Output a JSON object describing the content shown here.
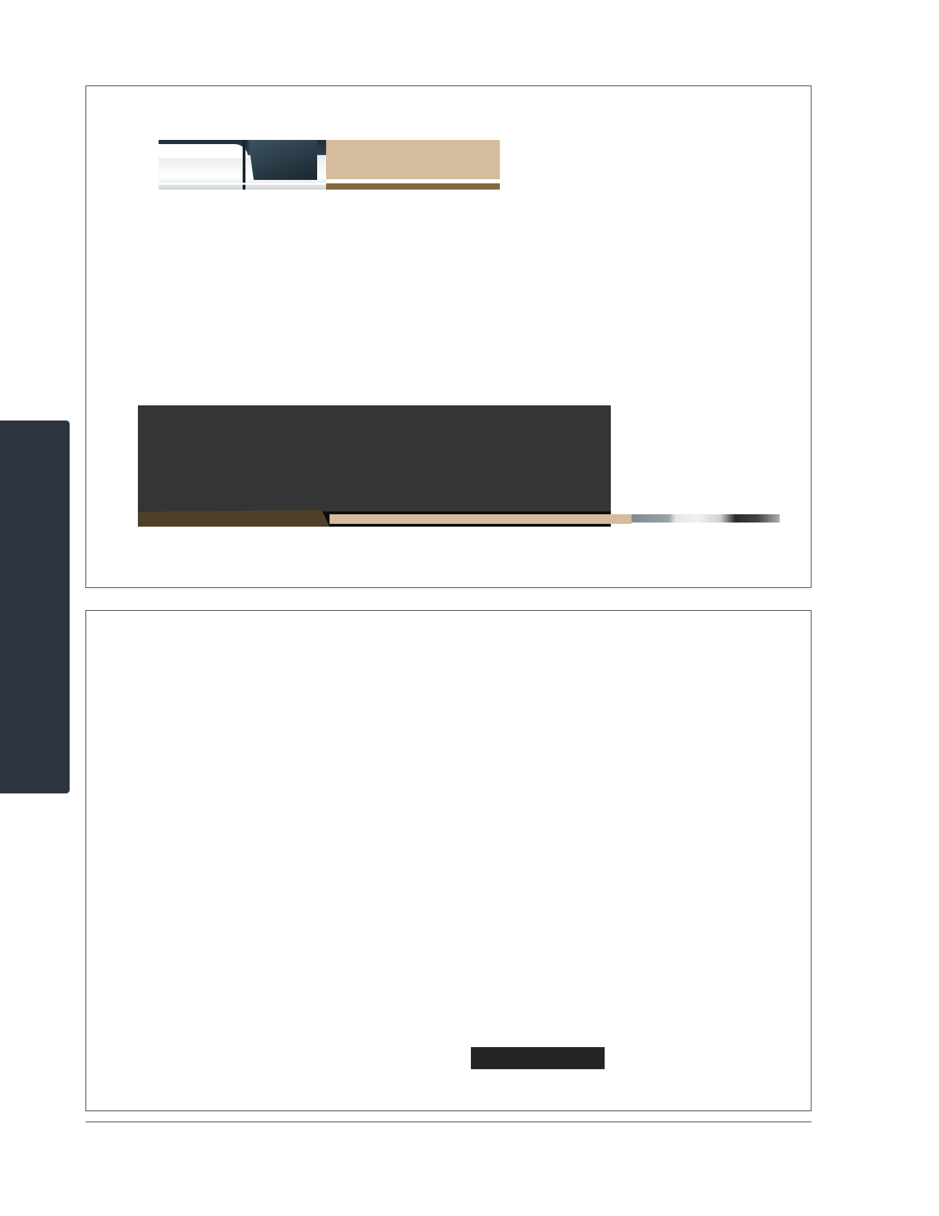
{
  "page": {
    "colors": {
      "side_tab": "#2d3640",
      "banner_tan": "#d4bc9c",
      "banner_brown": "#85693f",
      "panel_dark": "#353535",
      "button_dark": "#262526"
    }
  },
  "slide_1": {
    "banner": {},
    "dark_panel": {}
  },
  "slide_2": {
    "button": {}
  }
}
